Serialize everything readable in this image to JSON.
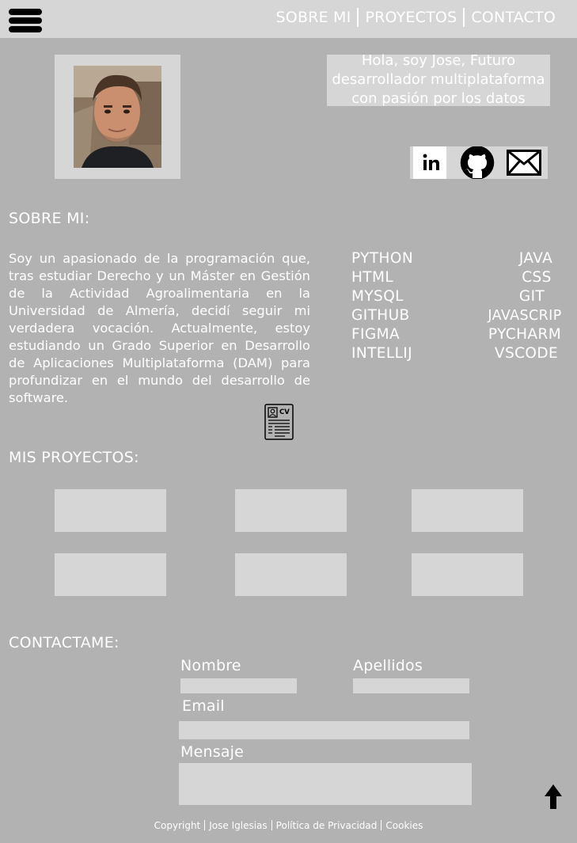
{
  "nav": {
    "about": "SOBRE MI",
    "projects": "PROYECTOS",
    "contact": "CONTACTO"
  },
  "intro": {
    "line1": "Hola, soy Jose, Futuro",
    "line2": "desarrollador multiplataforma",
    "line3": "con pasión por los datos"
  },
  "social": [
    "linkedin-icon",
    "github-icon",
    "mail-icon"
  ],
  "about": {
    "title": "SOBRE MI:",
    "text": "Soy un apasionado de la programación que, tras estudiar Derecho y un Máster en Gestión de la Actividad Agroalimentaria en la Universidad de Almería, decidí seguir mi verdadera vocación. Actualmente, estoy estudiando un Grado Superior en Desarrollo de Aplicaciones Multiplataforma (DAM) para profundizar en el mundo del desarrollo de software."
  },
  "skills": {
    "left": [
      "PYTHON",
      "HTML",
      "MYSQL",
      "GITHUB",
      "FIGMA",
      "INTELLIJ"
    ],
    "right": [
      "JAVA",
      "CSS",
      "GIT",
      "JAVASCRIP",
      "PYCHARM",
      "VSCODE"
    ]
  },
  "cv_icon": "CV",
  "projects": {
    "title": "MIS PROYECTOS:"
  },
  "contact": {
    "title": "CONTACTAME:",
    "name_label": "Nombre",
    "surname_label": "Apellidos",
    "email_label": "Email",
    "message_label": "Mensaje"
  },
  "footer": {
    "copyright": "Copyright",
    "author": "Jose Iglesias",
    "privacy": "Política de Privacidad",
    "cookies": "Cookies"
  }
}
